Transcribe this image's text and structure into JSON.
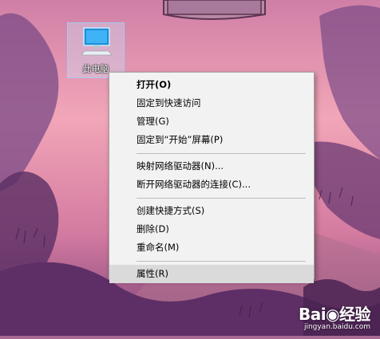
{
  "desktop": {
    "icon": {
      "label": "此电脑",
      "icon_name": "computer-icon"
    }
  },
  "context_menu": {
    "groups": [
      [
        {
          "label": "打开(O)",
          "bold": true
        },
        {
          "label": "固定到快速访问"
        },
        {
          "label": "管理(G)"
        },
        {
          "label": "固定到“开始”屏幕(P)"
        }
      ],
      [
        {
          "label": "映射网络驱动器(N)..."
        },
        {
          "label": "断开网络驱动器的连接(C)..."
        }
      ],
      [
        {
          "label": "创建快捷方式(S)"
        },
        {
          "label": "删除(D)"
        },
        {
          "label": "重命名(M)"
        }
      ],
      [
        {
          "label": "属性(R)",
          "highlighted": true
        }
      ]
    ]
  },
  "watermark": {
    "logo": "Bai◉经验",
    "url": "jingyan.baidu.com"
  },
  "colors": {
    "menu_bg": "#f2f2f2",
    "menu_highlight": "#dadada",
    "desktop_sky": "#f0a0b4",
    "desktop_ground": "#6e3c70"
  }
}
